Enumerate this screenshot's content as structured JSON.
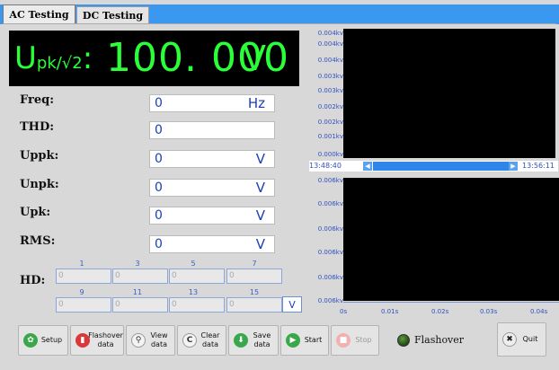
{
  "tabs": [
    "AC Testing",
    "DC Testing"
  ],
  "display": {
    "label": "U",
    "label_sub": "pk/√2",
    "sep": ":",
    "value": "100. 000",
    "unit": "V"
  },
  "measurements": [
    {
      "label": "Freq:",
      "value": "0",
      "unit": "Hz"
    },
    {
      "label": "THD:",
      "value": "0",
      "unit": ""
    },
    {
      "label": "Uppk:",
      "value": "0",
      "unit": "V"
    },
    {
      "label": "Unpk:",
      "value": "0",
      "unit": "V"
    },
    {
      "label": "Upk:",
      "value": "0",
      "unit": "V"
    },
    {
      "label": "RMS:",
      "value": "0",
      "unit": "V"
    }
  ],
  "hd": {
    "label": "HD:",
    "row1_orders": [
      "1",
      "3",
      "5",
      "7"
    ],
    "row2_orders": [
      "9",
      "11",
      "13",
      "15"
    ],
    "row1_values": [
      "0",
      "0",
      "0",
      "0"
    ],
    "row2_values": [
      "0",
      "0",
      "0",
      "0"
    ],
    "unit": "V"
  },
  "chart_top": {
    "y_ticks": [
      "0.004kv",
      "0.004kv",
      "0.004kv",
      "0.003kv",
      "0.003kv",
      "0.002kv",
      "0.002kv",
      "0.001kv",
      "0.000kv"
    ],
    "time_start": "13:48:40",
    "time_end": "13:56:11"
  },
  "chart_bottom": {
    "y_ticks": [
      "0.006kv",
      "0.006kv",
      "0.006kv",
      "0.006kv",
      "0.006kv",
      "0.006kv"
    ],
    "x_ticks": [
      "0s",
      "0.01s",
      "0.02s",
      "0.03s",
      "0.04s"
    ]
  },
  "buttons": {
    "setup": "Setup",
    "flashover_data": "Flashover\ndata",
    "view_data": "View\ndata",
    "clear_data": "Clear\ndata",
    "save_data": "Save\ndata",
    "start": "Start",
    "stop": "Stop",
    "quit": "Quit"
  },
  "flashover_indicator": "Flashover",
  "colors": {
    "display_text": "#2aff3a",
    "value_text": "#1a3fb8",
    "tab_bar": "#3a98f0"
  }
}
